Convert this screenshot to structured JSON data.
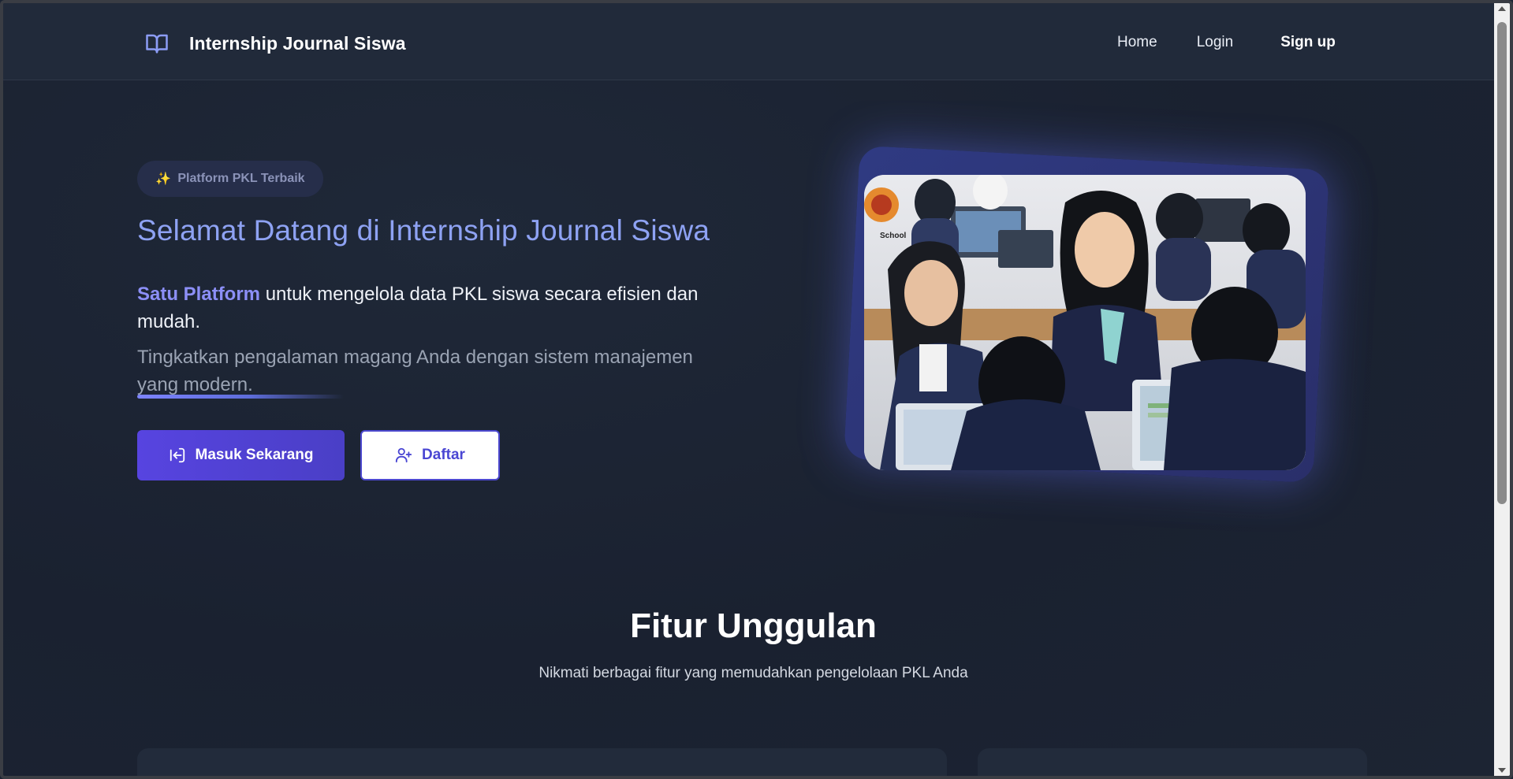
{
  "navbar": {
    "brand_icon": "book-open-icon",
    "brand_title": "Internship Journal Siswa",
    "links": {
      "home": "Home",
      "login": "Login",
      "signup": "Sign up"
    }
  },
  "hero": {
    "badge_icon": "sparkles-icon",
    "badge_text": "Platform PKL Terbaik",
    "title": "Selamat Datang di Internship Journal Siswa",
    "desc_highlight": "Satu Platform",
    "desc_rest": " untuk mengelola data PKL siswa secara efisien dan mudah.",
    "subtext": "Tingkatkan pengalaman magang Anda dengan sistem manajemen yang modern.",
    "primary_button": {
      "label": "Masuk Sekarang",
      "icon": "login-icon"
    },
    "secondary_button": {
      "label": "Daftar",
      "icon": "user-plus-icon"
    },
    "image_logo_text": "School"
  },
  "features": {
    "title": "Fitur Unggulan",
    "subtitle": "Nikmati berbagai fitur yang memudahkan pengelolaan PKL Anda"
  },
  "colors": {
    "accent": "#8c8ff7",
    "title_blue": "#8ea2f3",
    "primary_button": "#5744e0",
    "background": "#1b2333"
  }
}
